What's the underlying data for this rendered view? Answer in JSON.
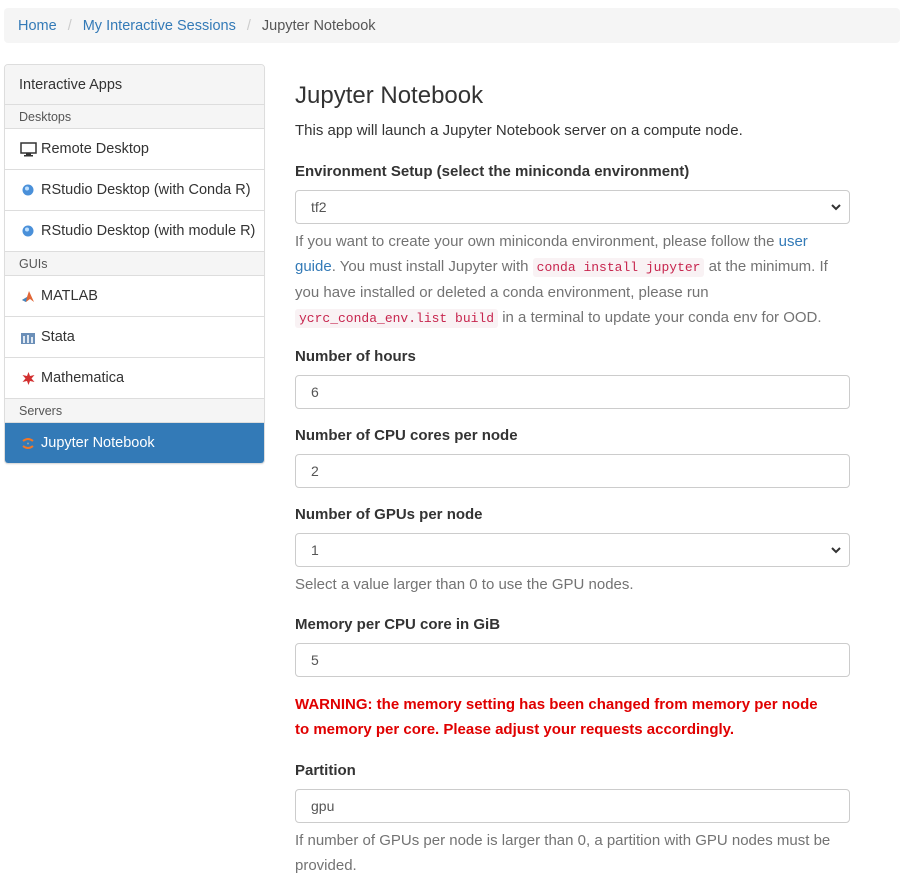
{
  "breadcrumb": {
    "home": "Home",
    "sessions": "My Interactive Sessions",
    "current": "Jupyter Notebook"
  },
  "sidebar": {
    "heading": "Interactive Apps",
    "groups": {
      "desktops": "Desktops",
      "guis": "GUIs",
      "servers": "Servers"
    },
    "items": {
      "remote_desktop": "Remote Desktop",
      "rstudio_conda": "RStudio Desktop (with Conda R)",
      "rstudio_module": "RStudio Desktop (with module R)",
      "matlab": "MATLAB",
      "stata": "Stata",
      "mathematica": "Mathematica",
      "jupyter": "Jupyter Notebook"
    }
  },
  "main": {
    "title": "Jupyter Notebook",
    "description": "This app will launch a Jupyter Notebook server on a compute node.",
    "environment": {
      "label": "Environment Setup (select the miniconda environment)",
      "value": "tf2",
      "help_1": "If you want to create your own miniconda environment, please follow the ",
      "help_link": "user guide",
      "help_2": ". You must install Jupyter with ",
      "help_code_1": "conda install jupyter",
      "help_3": " at the minimum. If you have installed or deleted a conda environment, please run ",
      "help_code_2": "ycrc_conda_env.list build",
      "help_4": " in a terminal to update your conda env for OOD."
    },
    "hours": {
      "label": "Number of hours",
      "value": "6"
    },
    "cpus": {
      "label": "Number of CPU cores per node",
      "value": "2"
    },
    "gpus": {
      "label": "Number of GPUs per node",
      "value": "1",
      "help": "Select a value larger than 0 to use the GPU nodes."
    },
    "memory": {
      "label": "Memory per CPU core in GiB",
      "value": "5"
    },
    "warning": "WARNING: the memory setting has been changed from memory per node to memory per core. Please adjust your requests accordingly.",
    "partition": {
      "label": "Partition",
      "value": "gpu",
      "help": "If number of GPUs per node is larger than 0, a partition with GPU nodes must be provided."
    }
  },
  "colors": {
    "link": "#337ab7",
    "active_bg": "#337ab7",
    "warning": "#e00000",
    "code": "#c7254e"
  },
  "icons": {
    "remote_desktop": "monitor-icon",
    "rstudio": "rstudio-icon",
    "matlab": "matlab-icon",
    "stata": "stata-icon",
    "mathematica": "mathematica-icon",
    "jupyter": "jupyter-icon",
    "select": "chevron-down-icon"
  }
}
